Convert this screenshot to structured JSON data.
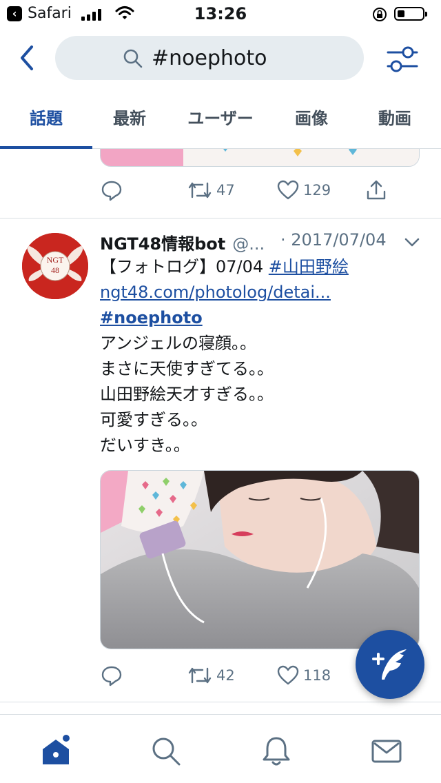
{
  "status_bar": {
    "back_app": "Safari",
    "time": "13:26"
  },
  "search": {
    "query": "#noephoto"
  },
  "tabs": [
    {
      "label": "話題",
      "active": true
    },
    {
      "label": "最新",
      "active": false
    },
    {
      "label": "ユーザー",
      "active": false
    },
    {
      "label": "画像",
      "active": false
    },
    {
      "label": "動画",
      "active": false
    }
  ],
  "previous_tweet": {
    "retweets": "47",
    "likes": "129"
  },
  "tweet": {
    "name": "NGT48情報bot",
    "handle": "@...",
    "date": "· 2017/07/04",
    "avatar_text": "NGT 48",
    "line1_prefix": "【フォトログ】07/04 ",
    "line1_link": "#山田野絵",
    "line2_link": "ngt48.com/photolog/detai...",
    "line3_link": "#noephoto",
    "line4": "アンジェルの寝顔。。",
    "line5": "まさに天使すぎてる。。",
    "line6": "山田野絵天才すぎる。。",
    "line7": "可愛すぎる。。",
    "line8": "だいすき。。",
    "retweets": "42",
    "likes": "118"
  },
  "colors": {
    "accent": "#1d4fa1",
    "muted": "#5b7083",
    "divider": "#d8dee3"
  },
  "icons": {
    "reply": "speech-bubble-icon",
    "retweet": "retweet-icon",
    "like": "heart-icon",
    "share": "share-icon",
    "compose": "compose-tweet-icon",
    "home": "home-icon",
    "search": "search-icon",
    "notifications": "bell-icon",
    "messages": "envelope-icon"
  }
}
